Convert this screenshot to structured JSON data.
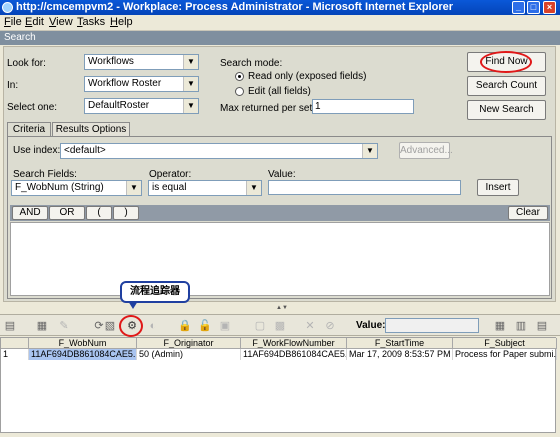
{
  "window": {
    "title": "http://cmcempvm2 - Workplace: Process Administrator - Microsoft Internet Explorer"
  },
  "menu": [
    "File",
    "Edit",
    "View",
    "Tasks",
    "Help"
  ],
  "search_header": "Search",
  "form": {
    "look_for_label": "Look for:",
    "look_for_value": "Workflows",
    "in_label": "In:",
    "in_value": "Workflow Roster",
    "select_one_label": "Select one:",
    "select_one_value": "DefaultRoster",
    "search_mode_label": "Search mode:",
    "mode_read_only": "Read only (exposed fields)",
    "mode_edit": "Edit (all fields)",
    "max_returned_label": "Max returned per set:",
    "max_returned_value": "1"
  },
  "buttons": {
    "find_now": "Find Now",
    "search_count": "Search Count",
    "new_search": "New Search"
  },
  "tabs": [
    "Criteria",
    "Results Options"
  ],
  "criteria": {
    "use_index_label": "Use index:",
    "use_index_value": "<default>",
    "advanced": "Advanced...",
    "search_fields_label": "Search Fields:",
    "search_fields_value": "F_WobNum (String)",
    "operator_label": "Operator:",
    "operator_value": "is equal",
    "value_label": "Value:",
    "value_value": "",
    "insert": "Insert",
    "logic": [
      "AND",
      "OR",
      "(",
      ")"
    ],
    "clear": "Clear"
  },
  "callout": "流程追踪器",
  "toolbar": {
    "value_label": "Value:",
    "value_value": ""
  },
  "grid": {
    "columns": [
      "F_WobNum",
      "F_Originator",
      "F_WorkFlowNumber",
      "F_StartTime",
      "F_Subject"
    ],
    "rows": [
      {
        "index": "1",
        "cells": [
          "11AF694DB861084CAE5...",
          "50 (Admin)",
          "11AF694DB861084CAE5...",
          "Mar 17, 2009 8:53:57 PM",
          "Process for Paper submi..."
        ]
      }
    ]
  },
  "colors": {
    "title_bar": "#0a58d8",
    "highlight": "#e01818",
    "selected_cell": "#a9c4f0"
  },
  "icons": [
    "ie-icon",
    "minimize-icon",
    "maximize-icon",
    "close-icon",
    "tracker-icon"
  ]
}
